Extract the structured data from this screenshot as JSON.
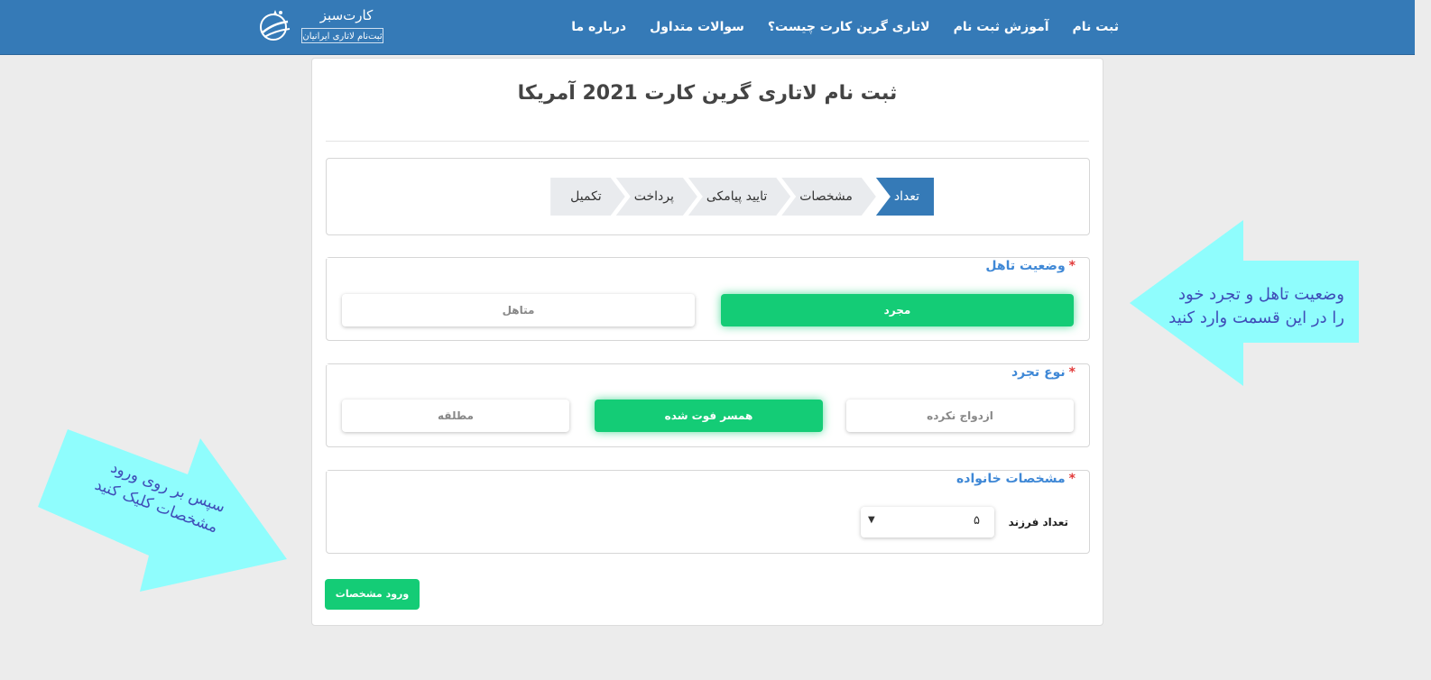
{
  "nav": {
    "links": [
      "ثبت نام",
      "آموزش ثبت نام",
      "لاتاری گرین کارت چیست؟",
      "سوالات متداول",
      "درباره ما"
    ],
    "logo_title": "کارت‌سبز",
    "logo_subtitle": "ثبت‌نام لاتاری ایرانیان"
  },
  "page": {
    "title": "ثبت نام لاتاری گرین کارت 2021 آمریکا"
  },
  "steps": {
    "items": [
      "تعداد",
      "مشخصات",
      "تایید پیامکی",
      "پرداخت",
      "تکمیل"
    ],
    "active_index": 0
  },
  "marital": {
    "legend": "وضعیت تاهل",
    "required_mark": "*",
    "options": [
      "مجرد",
      "متاهل"
    ],
    "selected": "مجرد"
  },
  "single_type": {
    "legend": "نوع تجرد",
    "required_mark": "*",
    "options": [
      "ازدواج نکرده",
      "همسر فوت شده",
      "مطلقه"
    ],
    "selected": "همسر فوت شده"
  },
  "family": {
    "legend": "مشخصات خانواده",
    "required_mark": "*",
    "children_label": "تعداد فرزند",
    "children_value": "۵"
  },
  "submit_label": "ورود مشخصات",
  "annotations": {
    "right_text": "وضعیت تاهل و تجرد خود را در این قسمت وارد کنید",
    "left_text": "سپس بر روی ورود مشخصات کلیک کنید",
    "arrow_color": "#8ffdfd"
  },
  "colors": {
    "navbar": "#357ab7",
    "active_step": "#357ab7",
    "green": "#14cc76",
    "legend": "#3f88d6",
    "required": "#e23b3b"
  }
}
